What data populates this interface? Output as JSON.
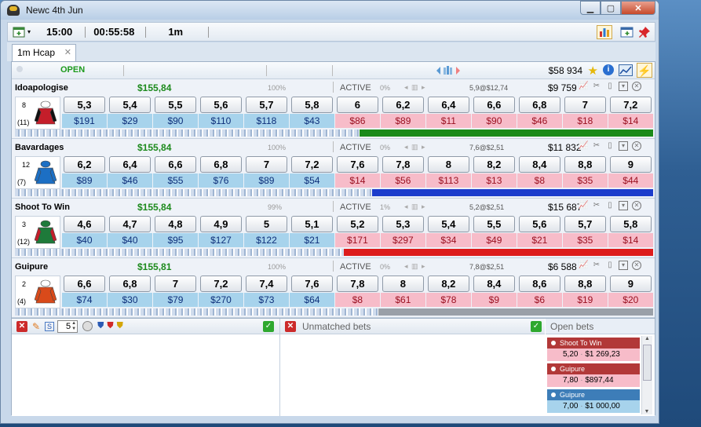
{
  "window": {
    "title": "Newc 4th Jun"
  },
  "toolbar": {
    "time": "15:00",
    "countdown": "00:55:58",
    "distance": "1m"
  },
  "tabs": [
    {
      "label": "1m Hcap"
    }
  ],
  "summary": {
    "status": "OPEN",
    "total_matched": "$58 934"
  },
  "colors": {
    "back": "#a7d3ec",
    "lay": "#f7bcc9",
    "profit": "#1d8a1d"
  },
  "runners": [
    {
      "name": "Idoapologise",
      "profit": "$155,84",
      "pct": "100%",
      "status": "ACTIVE",
      "pct2": "0%",
      "last_traded": "5,9@$12,74",
      "volume": "$9 759",
      "number": "8",
      "stall": "(11)",
      "silk": {
        "body": "#c41e2a",
        "sleeves": "#111111",
        "cap": "#ffffff"
      },
      "back": [
        {
          "price": "5,3",
          "amount": "$191"
        },
        {
          "price": "5,4",
          "amount": "$29"
        },
        {
          "price": "5,5",
          "amount": "$90"
        },
        {
          "price": "5,6",
          "amount": "$110"
        },
        {
          "price": "5,7",
          "amount": "$118"
        },
        {
          "price": "5,8",
          "amount": "$43"
        }
      ],
      "lay": [
        {
          "price": "6",
          "amount": "$86"
        },
        {
          "price": "6,2",
          "amount": "$89"
        },
        {
          "price": "6,4",
          "amount": "$11"
        },
        {
          "price": "6,6",
          "amount": "$90"
        },
        {
          "price": "6,8",
          "amount": "$46"
        },
        {
          "price": "7",
          "amount": "$18"
        },
        {
          "price": "7,2",
          "amount": "$14"
        }
      ],
      "wom": {
        "fraction": 0.46,
        "color": "#1a8a1a"
      }
    },
    {
      "name": "Bavardages",
      "profit": "$155,84",
      "pct": "100%",
      "status": "ACTIVE",
      "pct2": "0%",
      "last_traded": "7,6@$2,51",
      "volume": "$11 832",
      "number": "12",
      "stall": "(7)",
      "silk": {
        "body": "#1c6fc4",
        "sleeves": "#1c6fc4",
        "cap": "#1c6fc4"
      },
      "back": [
        {
          "price": "6,2",
          "amount": "$89"
        },
        {
          "price": "6,4",
          "amount": "$46"
        },
        {
          "price": "6,6",
          "amount": "$55"
        },
        {
          "price": "6,8",
          "amount": "$76"
        },
        {
          "price": "7",
          "amount": "$89"
        },
        {
          "price": "7,2",
          "amount": "$54"
        }
      ],
      "lay": [
        {
          "price": "7,6",
          "amount": "$14"
        },
        {
          "price": "7,8",
          "amount": "$56"
        },
        {
          "price": "8",
          "amount": "$113"
        },
        {
          "price": "8,2",
          "amount": "$13"
        },
        {
          "price": "8,4",
          "amount": "$8"
        },
        {
          "price": "8,8",
          "amount": "$35"
        },
        {
          "price": "9",
          "amount": "$44"
        }
      ],
      "wom": {
        "fraction": 0.44,
        "color": "#1b3ccc"
      }
    },
    {
      "name": "Shoot To Win",
      "profit": "$155,84",
      "pct": "99%",
      "status": "ACTIVE",
      "pct2": "1%",
      "last_traded": "5,2@$2,51",
      "volume": "$15 687",
      "number": "3",
      "stall": "(12)",
      "silk": {
        "body": "#1e7a3a",
        "sleeves": "#c41e2a",
        "cap": "#1e7a3a"
      },
      "back": [
        {
          "price": "4,6",
          "amount": "$40"
        },
        {
          "price": "4,7",
          "amount": "$40"
        },
        {
          "price": "4,8",
          "amount": "$95"
        },
        {
          "price": "4,9",
          "amount": "$127"
        },
        {
          "price": "5",
          "amount": "$122"
        },
        {
          "price": "5,1",
          "amount": "$21"
        }
      ],
      "lay": [
        {
          "price": "5,2",
          "amount": "$171"
        },
        {
          "price": "5,3",
          "amount": "$297"
        },
        {
          "price": "5,4",
          "amount": "$34"
        },
        {
          "price": "5,5",
          "amount": "$49"
        },
        {
          "price": "5,6",
          "amount": "$21"
        },
        {
          "price": "5,7",
          "amount": "$35"
        },
        {
          "price": "5,8",
          "amount": "$14"
        }
      ],
      "wom": {
        "fraction": 0.485,
        "color": "#dd1c1c"
      }
    },
    {
      "name": "Guipure",
      "profit": "$155,81",
      "pct": "100%",
      "status": "ACTIVE",
      "pct2": "0%",
      "last_traded": "7,8@$2,51",
      "volume": "$6 588",
      "number": "2",
      "stall": "(4)",
      "silk": {
        "body": "#d94a1a",
        "sleeves": "#d94a1a",
        "cap": "#ffffff"
      },
      "back": [
        {
          "price": "6,6",
          "amount": "$74"
        },
        {
          "price": "6,8",
          "amount": "$30"
        },
        {
          "price": "7",
          "amount": "$79"
        },
        {
          "price": "7,2",
          "amount": "$270"
        },
        {
          "price": "7,4",
          "amount": "$73"
        },
        {
          "price": "7,6",
          "amount": "$64"
        }
      ],
      "lay": [
        {
          "price": "7,8",
          "amount": "$8"
        },
        {
          "price": "8",
          "amount": "$61"
        },
        {
          "price": "8,2",
          "amount": "$78"
        },
        {
          "price": "8,4",
          "amount": "$9"
        },
        {
          "price": "8,6",
          "amount": "$6"
        },
        {
          "price": "8,8",
          "amount": "$19"
        },
        {
          "price": "9",
          "amount": "$20"
        }
      ],
      "wom": {
        "fraction": 0.43,
        "color": "#9aa0a8"
      }
    }
  ],
  "bet_panel": {
    "stake_value": "5"
  },
  "unmatched": {
    "title": "Unmatched bets"
  },
  "open_bets": {
    "title": "Open bets",
    "items": [
      {
        "runner": "Shoot To Win",
        "price": "5,20",
        "amount": "$1 269,23",
        "side": "lay"
      },
      {
        "runner": "Guipure",
        "price": "7,80",
        "amount": "$897,44",
        "side": "lay"
      },
      {
        "runner": "Guipure",
        "price": "7,00",
        "amount": "$1 000,00",
        "side": "back"
      }
    ]
  }
}
